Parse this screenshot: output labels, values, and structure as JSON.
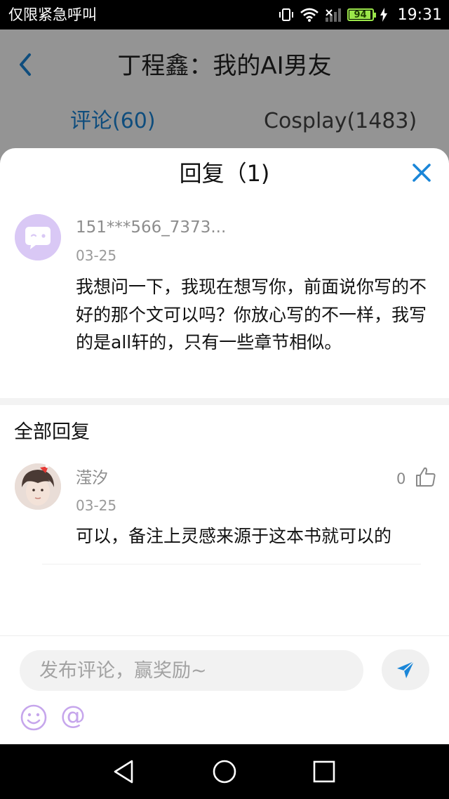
{
  "status_bar": {
    "carrier_text": "仅限紧急呼叫",
    "battery_level": "94",
    "time": "19:31"
  },
  "page": {
    "title": "丁程鑫：我的AI男友",
    "tabs": [
      {
        "label": "评论(60)",
        "active": true
      },
      {
        "label": "Cosplay(1483)",
        "active": false
      }
    ]
  },
  "sheet": {
    "title": "回复（1)",
    "original_comment": {
      "username": "151***566_7373...",
      "date": "03-25",
      "text": "我想问一下，我现在想写你，前面说你写的不好的那个文可以吗？你放心写的不一样，我写的是all轩的，只有一些章节相似。"
    },
    "section_label": "全部回复",
    "replies": [
      {
        "username": "滢汐",
        "date": "03-25",
        "text": "可以，备注上灵感来源于这本书就可以的",
        "likes": "0"
      }
    ]
  },
  "composer": {
    "placeholder": "发布评论，赢奖励~",
    "at_symbol": "@"
  },
  "colors": {
    "accent": "#1a86d8",
    "send_icon": "#1a86d8",
    "emoji_icon": "#c6a6ec",
    "battery": "#9be64a"
  },
  "icons": {
    "back": "chevron-left-icon",
    "close": "close-icon",
    "like": "thumbs-up-icon",
    "send": "paper-plane-icon",
    "emoji": "smiley-icon"
  }
}
